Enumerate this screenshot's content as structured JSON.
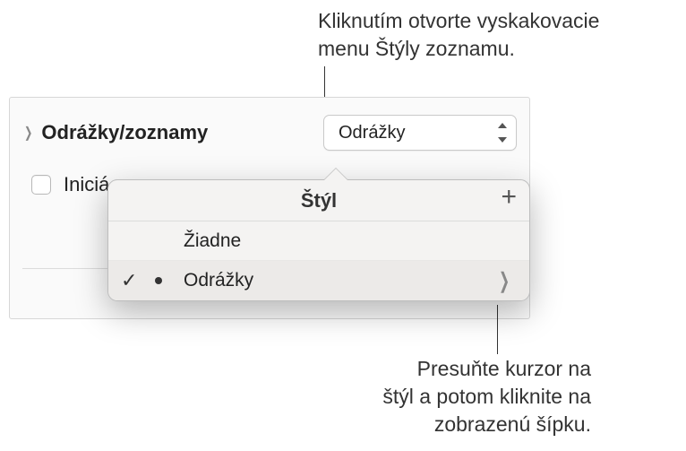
{
  "callouts": {
    "top": "Kliknutím otvorte vyskakovacie\nmenu Štýly zoznamu.",
    "bottom": "Presuňte kurzor na\nštýl a potom kliknite na\nzobrazenú šípku."
  },
  "panel": {
    "section_label": "Odrážky/zoznamy",
    "dropdown_value": "Odrážky",
    "checkbox_label": "Iniciá"
  },
  "popover": {
    "title": "Štýl",
    "add_label": "+",
    "items": [
      {
        "label": "Žiadne",
        "selected": false,
        "has_chevron": false,
        "has_bullet": false
      },
      {
        "label": "Odrážky",
        "selected": true,
        "has_chevron": true,
        "has_bullet": true
      }
    ]
  }
}
